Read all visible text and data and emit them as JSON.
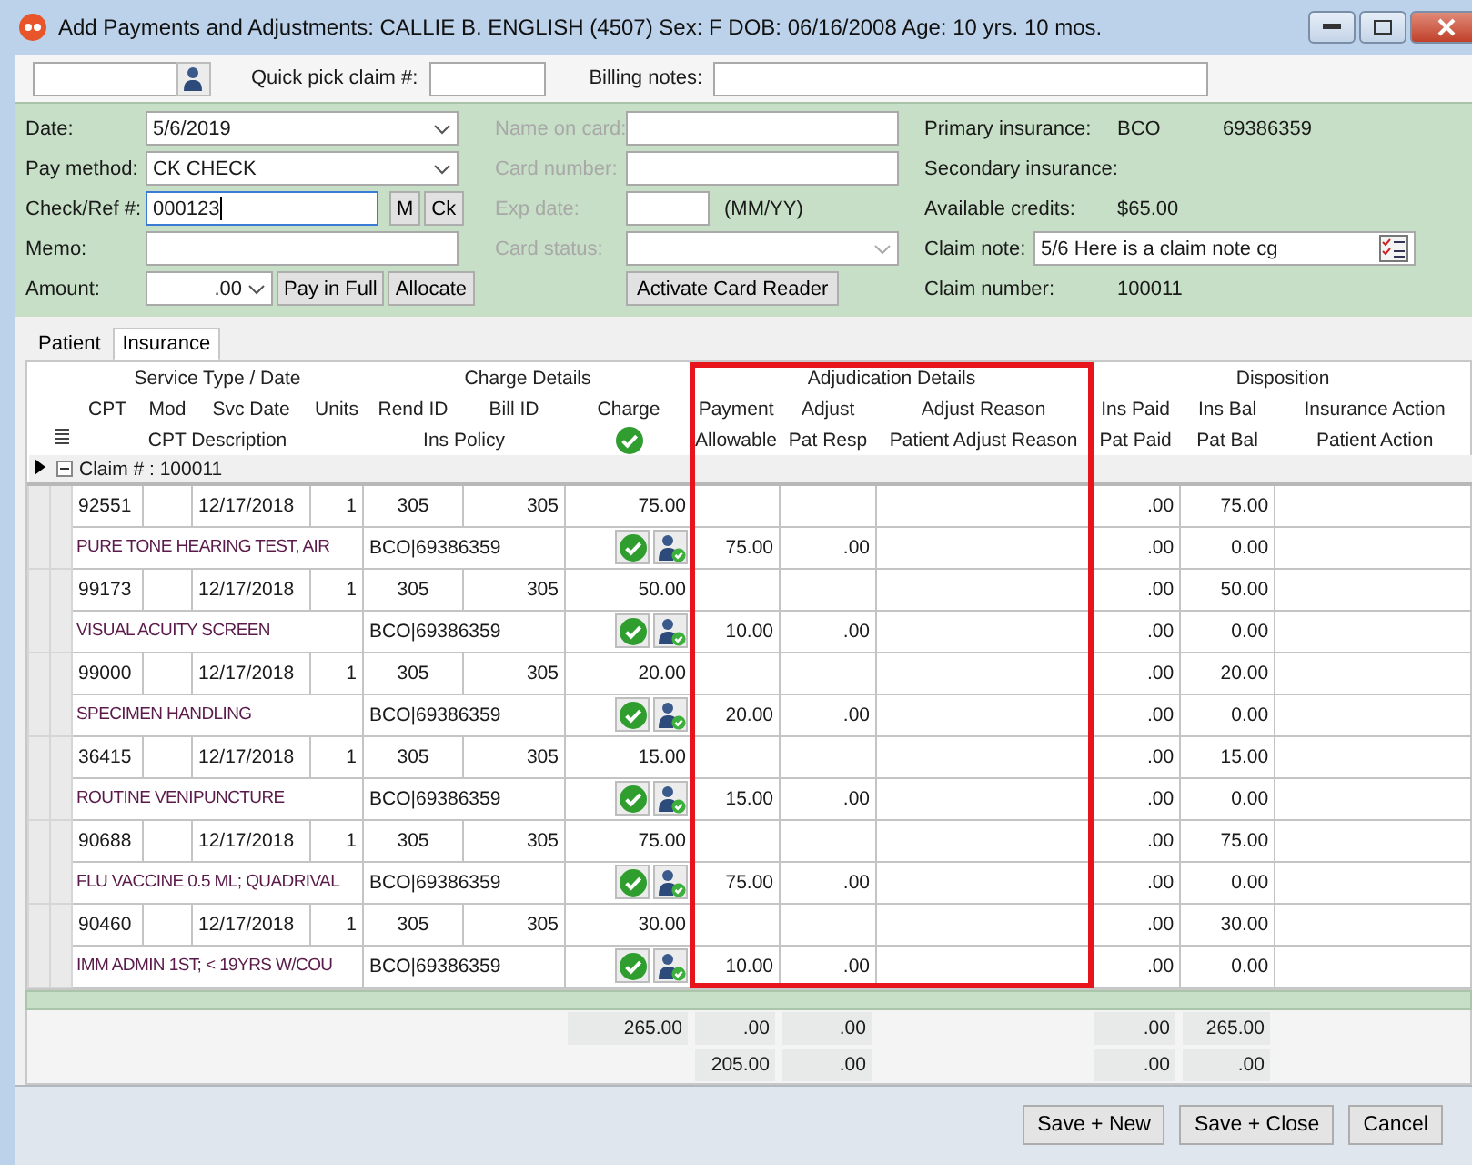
{
  "window": {
    "title": "Add Payments and Adjustments: CALLIE B. ENGLISH (4507)  Sex: F  DOB: 06/16/2008  Age: 10 yrs. 10 mos."
  },
  "toolbar": {
    "quick_pick_label": "Quick pick claim #:",
    "billing_notes_label": "Billing notes:"
  },
  "payment_fields": [
    {
      "kind": "select",
      "label": "Date:",
      "value": "5/6/2019"
    },
    {
      "kind": "select",
      "label": "Pay method:",
      "value": "CK  CHECK"
    },
    {
      "kind": "ref",
      "label": "Check/Ref #:",
      "value": "000123",
      "focused": true,
      "buttons": [
        "M",
        "Ck"
      ]
    },
    {
      "kind": "input",
      "label": "Memo:"
    },
    {
      "kind": "amount",
      "label": "Amount:",
      "value": ".00",
      "buttons": [
        "Pay in Full",
        "Allocate"
      ]
    }
  ],
  "card": {
    "fields": [
      {
        "kind": "input",
        "label": "Name on card:",
        "disabled": true
      },
      {
        "kind": "input",
        "label": "Card number:",
        "disabled": true
      },
      {
        "kind": "short",
        "label": "Exp date:",
        "hint": "(MM/YY)",
        "disabled": true
      },
      {
        "kind": "select",
        "label": "Card status:",
        "disabled": true
      }
    ],
    "button": "Activate Card Reader"
  },
  "claim_info": [
    {
      "kind": "text",
      "label": "Primary insurance:",
      "values": [
        "BCO",
        "69386359"
      ]
    },
    {
      "kind": "text",
      "label": "Secondary insurance:"
    },
    {
      "kind": "text",
      "label": "Available credits:",
      "values": [
        "$65.00"
      ]
    },
    {
      "kind": "note",
      "label": "Claim note:",
      "value": "5/6 Here is a claim note cg"
    },
    {
      "kind": "text",
      "label": "Claim number:",
      "values": [
        "100011"
      ]
    }
  ],
  "tabs": [
    {
      "label": "Patient",
      "selected": false
    },
    {
      "label": "Insurance",
      "selected": true
    }
  ],
  "grid": {
    "groups": [
      {
        "label": "Service Type / Date",
        "bottom": "CPT Description",
        "columns": [
          {
            "top": "CPT"
          },
          {
            "top": "Mod"
          },
          {
            "top": "Svc Date"
          },
          {
            "top": "Units"
          }
        ]
      },
      {
        "label": "Charge Details",
        "bottom": "Ins Policy",
        "columns": [
          {
            "top": "Rend ID"
          },
          {
            "top": "Bill ID"
          },
          {
            "top": "Charge",
            "kind": "check"
          }
        ]
      },
      {
        "label": "Adjudication Details",
        "highlighted": true,
        "columns": [
          {
            "top": "Payment",
            "bottom": "Allowable"
          },
          {
            "top": "Adjust",
            "bottom": "Pat Resp"
          },
          {
            "top": "Adjust Reason",
            "bottom": "Patient Adjust Reason"
          }
        ]
      },
      {
        "label": "Disposition",
        "columns": [
          {
            "top": "Ins Paid",
            "bottom": "Pat Paid"
          },
          {
            "top": "Ins Bal",
            "bottom": "Pat Bal"
          },
          {
            "top": "Insurance Action",
            "bottom": "Patient Action"
          }
        ]
      }
    ],
    "claim": {
      "label": "Claim # : 100011",
      "expanded": true
    },
    "lines": [
      {
        "cpt": "92551",
        "svc_date": "12/17/2018",
        "units": "1",
        "rend_id": "305",
        "bill_id": "305",
        "charge": "75.00",
        "description": "PURE TONE HEARING TEST, AIR",
        "ins_policy": "BCO|69386359",
        "allowable": "75.00",
        "pat_resp": ".00",
        "ins_paid": ".00",
        "ins_bal": "75.00",
        "pat_paid": ".00",
        "pat_bal": "0.00"
      },
      {
        "cpt": "99173",
        "svc_date": "12/17/2018",
        "units": "1",
        "rend_id": "305",
        "bill_id": "305",
        "charge": "50.00",
        "description": "VISUAL ACUITY SCREEN",
        "ins_policy": "BCO|69386359",
        "allowable": "10.00",
        "pat_resp": ".00",
        "ins_paid": ".00",
        "ins_bal": "50.00",
        "pat_paid": ".00",
        "pat_bal": "0.00"
      },
      {
        "cpt": "99000",
        "svc_date": "12/17/2018",
        "units": "1",
        "rend_id": "305",
        "bill_id": "305",
        "charge": "20.00",
        "description": "SPECIMEN HANDLING",
        "ins_policy": "BCO|69386359",
        "allowable": "20.00",
        "pat_resp": ".00",
        "ins_paid": ".00",
        "ins_bal": "20.00",
        "pat_paid": ".00",
        "pat_bal": "0.00"
      },
      {
        "cpt": "36415",
        "svc_date": "12/17/2018",
        "units": "1",
        "rend_id": "305",
        "bill_id": "305",
        "charge": "15.00",
        "description": "ROUTINE VENIPUNCTURE",
        "ins_policy": "BCO|69386359",
        "allowable": "15.00",
        "pat_resp": ".00",
        "ins_paid": ".00",
        "ins_bal": "15.00",
        "pat_paid": ".00",
        "pat_bal": "0.00"
      },
      {
        "cpt": "90688",
        "svc_date": "12/17/2018",
        "units": "1",
        "rend_id": "305",
        "bill_id": "305",
        "charge": "75.00",
        "description": "FLU VACCINE 0.5 ML; QUADRIVAL",
        "ins_policy": "BCO|69386359",
        "allowable": "75.00",
        "pat_resp": ".00",
        "ins_paid": ".00",
        "ins_bal": "75.00",
        "pat_paid": ".00",
        "pat_bal": "0.00"
      },
      {
        "cpt": "90460",
        "svc_date": "12/17/2018",
        "units": "1",
        "rend_id": "305",
        "bill_id": "305",
        "charge": "30.00",
        "description": "IMM ADMIN 1ST; < 19YRS W/COU",
        "ins_policy": "BCO|69386359",
        "allowable": "10.00",
        "pat_resp": ".00",
        "ins_paid": ".00",
        "ins_bal": "30.00",
        "pat_paid": ".00",
        "pat_bal": "0.00"
      }
    ],
    "totals": [
      {
        "charge": "265.00",
        "payment": ".00",
        "adjust": ".00",
        "ins_paid": ".00",
        "ins_bal": "265.00"
      },
      {
        "allowable": "205.00",
        "pat_resp": ".00",
        "pat_paid": ".00",
        "pat_bal": ".00"
      }
    ]
  },
  "buttons": [
    "Save + New",
    "Save + Close",
    "Cancel"
  ]
}
